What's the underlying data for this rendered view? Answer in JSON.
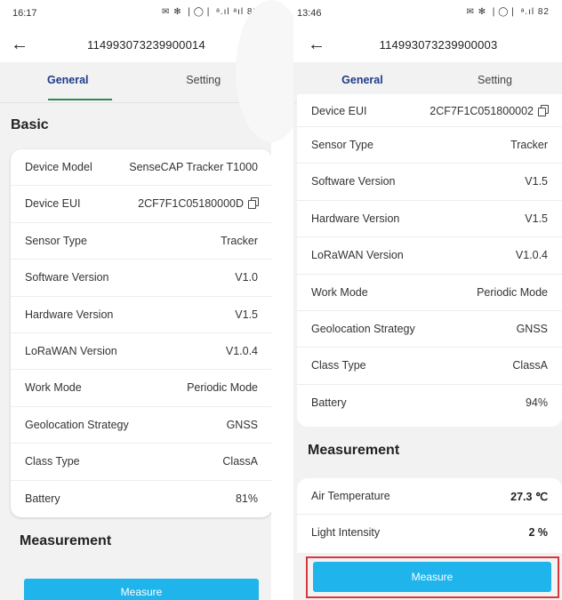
{
  "left": {
    "status_time": "16:17",
    "status_icons": "✉ ✻ ❘◯❘ ᵃ.ıl ᵃıl 82",
    "device_id": "114993073239900014",
    "tabs": {
      "general": "General",
      "setting": "Setting"
    },
    "basic_title": "Basic",
    "rows": [
      {
        "label": "Device Model",
        "value": "SenseCAP Tracker T1000"
      },
      {
        "label": "Device EUI",
        "value": "2CF7F1C05180000D"
      },
      {
        "label": "Sensor Type",
        "value": "Tracker"
      },
      {
        "label": "Software Version",
        "value": "V1.0"
      },
      {
        "label": "Hardware Version",
        "value": "V1.5"
      },
      {
        "label": "LoRaWAN Version",
        "value": "V1.0.4"
      },
      {
        "label": "Work Mode",
        "value": "Periodic Mode"
      },
      {
        "label": "Geolocation Strategy",
        "value": "GNSS"
      },
      {
        "label": "Class Type",
        "value": "ClassA"
      },
      {
        "label": "Battery",
        "value": "81%"
      }
    ],
    "measurement_title": "Measurement",
    "measure_button": "Measure"
  },
  "right": {
    "status_time": "13:46",
    "status_icons": "✉ ✻ ❘◯❘ ᵃ.ıl 82",
    "device_id": "114993073239900003",
    "tabs": {
      "general": "General",
      "setting": "Setting"
    },
    "rows": [
      {
        "label": "Device EUI",
        "value": "2CF7F1C051800002"
      },
      {
        "label": "Sensor Type",
        "value": "Tracker"
      },
      {
        "label": "Software Version",
        "value": "V1.5"
      },
      {
        "label": "Hardware Version",
        "value": "V1.5"
      },
      {
        "label": "LoRaWAN Version",
        "value": "V1.0.4"
      },
      {
        "label": "Work Mode",
        "value": "Periodic Mode"
      },
      {
        "label": "Geolocation Strategy",
        "value": "GNSS"
      },
      {
        "label": "Class Type",
        "value": "ClassA"
      },
      {
        "label": "Battery",
        "value": "94%"
      }
    ],
    "measurement_title": "Measurement",
    "measurements": [
      {
        "label": "Air Temperature",
        "value": "27.3 ℃"
      },
      {
        "label": "Light Intensity",
        "value": "2 %"
      }
    ],
    "measure_button": "Measure"
  },
  "colors": {
    "accent": "#1fb4eb",
    "tab_active_text": "#1f3b8a",
    "left_tab_underline": "#2e8b57",
    "right_tab_underline": "#3a3fb0",
    "highlight_border": "#d9363e",
    "background": "#f2f2f2"
  },
  "icons": {
    "back": "arrow-left-icon",
    "copy": "copy-icon"
  }
}
